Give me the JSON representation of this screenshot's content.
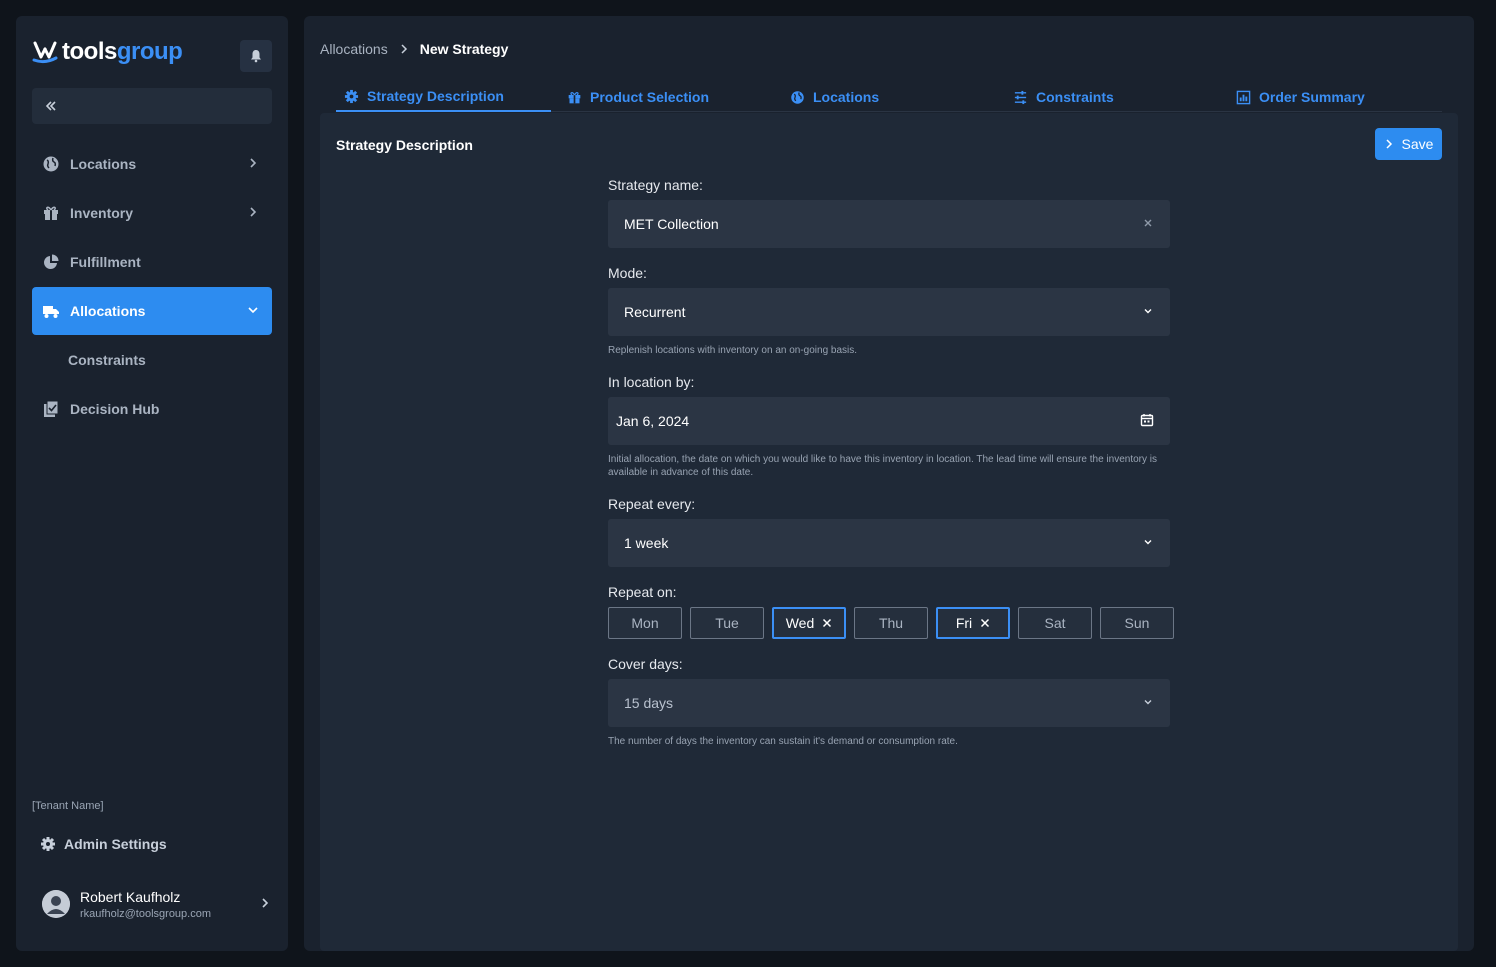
{
  "brand": {
    "name_part1": "tools",
    "name_part2": "group",
    "accent": "#2d8cf0"
  },
  "sidebar": {
    "items": [
      {
        "label": "Locations",
        "icon": "globe-icon",
        "has_chevron": true
      },
      {
        "label": "Inventory",
        "icon": "gift-icon",
        "has_chevron": true
      },
      {
        "label": "Fulfillment",
        "icon": "pie-chart-icon",
        "has_chevron": false
      },
      {
        "label": "Allocations",
        "icon": "truck-icon",
        "active": true,
        "expanded": true
      },
      {
        "label": "Decision Hub",
        "icon": "checklist-icon",
        "has_chevron": false
      }
    ],
    "sub_items": [
      {
        "label": "Constraints"
      }
    ],
    "tenant": "[Tenant Name]",
    "admin_settings": "Admin Settings",
    "user": {
      "name": "Robert Kaufholz",
      "email": "rkaufholz@toolsgroup.com"
    }
  },
  "breadcrumb": {
    "parent": "Allocations",
    "current": "New Strategy"
  },
  "tabs": [
    {
      "label": "Strategy Description",
      "icon": "gear-icon",
      "active": true
    },
    {
      "label": "Product Selection",
      "icon": "gift-icon"
    },
    {
      "label": "Locations",
      "icon": "globe-icon"
    },
    {
      "label": "Constraints",
      "icon": "sliders-icon"
    },
    {
      "label": "Order Summary",
      "icon": "report-icon"
    }
  ],
  "panel": {
    "title": "Strategy Description",
    "save_label": "Save"
  },
  "form": {
    "strategy_name": {
      "label": "Strategy name:",
      "value": "MET Collection"
    },
    "mode": {
      "label": "Mode:",
      "value": "Recurrent",
      "help": "Replenish locations with inventory on an on-going basis."
    },
    "in_location_by": {
      "label": "In location by:",
      "value": "Jan 6, 2024",
      "help": "Initial allocation, the date on which you would like to have this inventory in location. The lead time will ensure the inventory is available in advance of this date."
    },
    "repeat_every": {
      "label": "Repeat every:",
      "value": "1 week"
    },
    "repeat_on": {
      "label": "Repeat on:",
      "days": [
        {
          "label": "Mon",
          "selected": false
        },
        {
          "label": "Tue",
          "selected": false
        },
        {
          "label": "Wed",
          "selected": true
        },
        {
          "label": "Thu",
          "selected": false
        },
        {
          "label": "Fri",
          "selected": true
        },
        {
          "label": "Sat",
          "selected": false
        },
        {
          "label": "Sun",
          "selected": false
        }
      ]
    },
    "cover_days": {
      "label": "Cover days:",
      "value": "15 days",
      "help": "The number of days the inventory can sustain it's demand or consumption rate."
    }
  }
}
